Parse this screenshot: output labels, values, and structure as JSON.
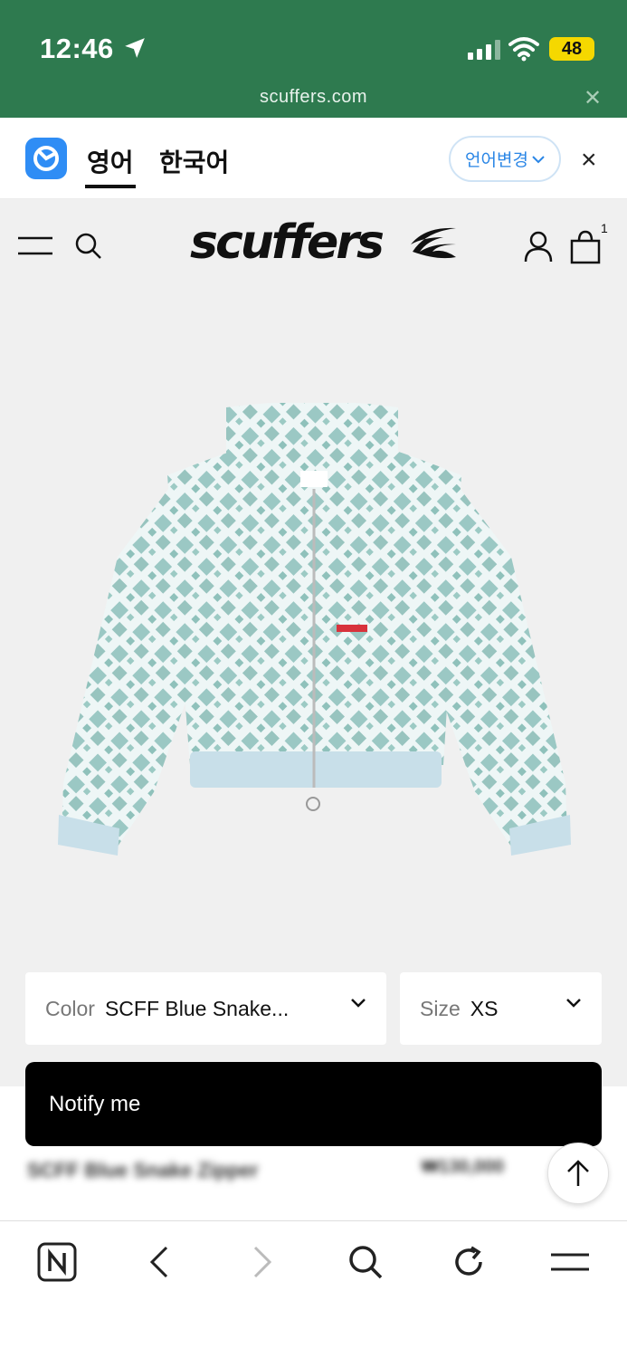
{
  "status_bar": {
    "time": "12:46",
    "battery": "48",
    "url": "scuffers.com"
  },
  "translate_bar": {
    "tab_english": "영어",
    "tab_korean": "한국어",
    "change_language": "언어변경",
    "close": "×"
  },
  "header": {
    "logo": "scuffers",
    "cart_count": "1"
  },
  "product": {
    "color_label": "Color",
    "color_value": "SCFF Blue Snake...",
    "size_label": "Size",
    "size_value": "XS",
    "notify_label": "Notify me",
    "name": "SCFF Blue Snake Zipper",
    "price": "₩130,000"
  },
  "colors": {
    "status_green": "#2e7a4f",
    "page_bg": "#f0f0f0",
    "accent_blue": "#2a86e6",
    "battery_yellow": "#f5d800"
  }
}
